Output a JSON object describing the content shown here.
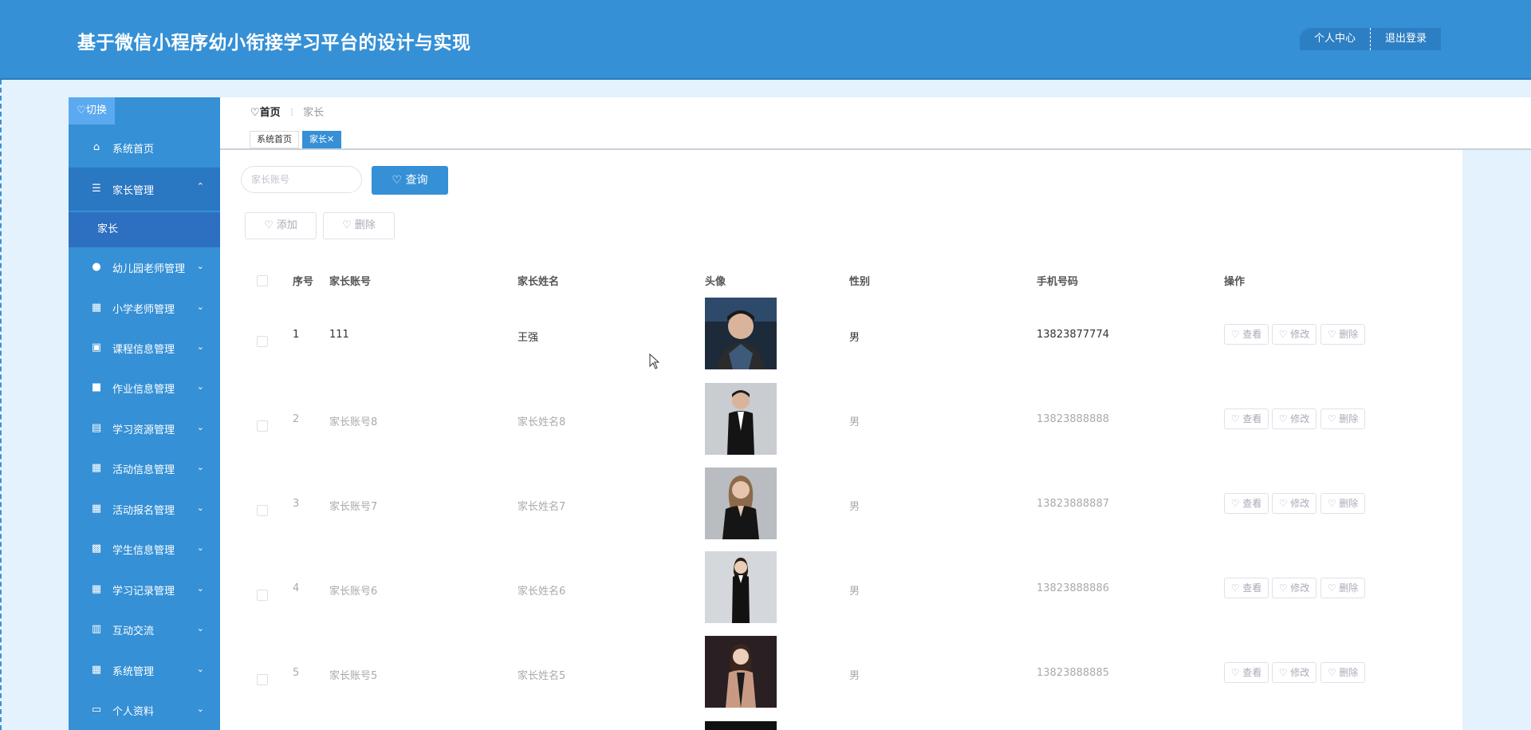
{
  "header": {
    "title": "基于微信小程序幼小衔接学习平台的设计与实现",
    "profile_label": "个人中心",
    "logout_label": "退出登录"
  },
  "sidebar": {
    "toggle_label": "切换",
    "items": [
      {
        "label": "系统首页",
        "icon": "home-icon"
      },
      {
        "label": "家长管理",
        "icon": "list-icon",
        "open": true
      },
      {
        "label": "幼儿园老师管理",
        "icon": "user-icon"
      },
      {
        "label": "小学老师管理",
        "icon": "grid-icon"
      },
      {
        "label": "课程信息管理",
        "icon": "briefcase-icon"
      },
      {
        "label": "作业信息管理",
        "icon": "chat-icon"
      },
      {
        "label": "学习资源管理",
        "icon": "book-icon"
      },
      {
        "label": "活动信息管理",
        "icon": "grid-icon"
      },
      {
        "label": "活动报名管理",
        "icon": "grid-icon"
      },
      {
        "label": "学生信息管理",
        "icon": "table-icon"
      },
      {
        "label": "学习记录管理",
        "icon": "grid-icon"
      },
      {
        "label": "互动交流",
        "icon": "clipboard-icon"
      },
      {
        "label": "系统管理",
        "icon": "grid-icon"
      },
      {
        "label": "个人资料",
        "icon": "id-card-icon"
      }
    ],
    "sub_item": "家长"
  },
  "breadcrumb": {
    "home": "首页",
    "current": "家长"
  },
  "tabs": [
    {
      "label": "系统首页"
    },
    {
      "label": "家长✕",
      "active": true
    }
  ],
  "search": {
    "placeholder": "家长账号",
    "button": "查询"
  },
  "actions": {
    "add": "添加",
    "delete": "删除"
  },
  "table": {
    "headers": [
      "序号",
      "家长账号",
      "家长姓名",
      "头像",
      "性别",
      "手机号码",
      "操作"
    ],
    "rows": [
      {
        "index": "1",
        "account": "111",
        "name": "王强",
        "gender": "男",
        "phone": "13823877774"
      },
      {
        "index": "2",
        "account": "家长账号8",
        "name": "家长姓名8",
        "gender": "男",
        "phone": "13823888888"
      },
      {
        "index": "3",
        "account": "家长账号7",
        "name": "家长姓名7",
        "gender": "男",
        "phone": "13823888887"
      },
      {
        "index": "4",
        "account": "家长账号6",
        "name": "家长姓名6",
        "gender": "男",
        "phone": "13823888886"
      },
      {
        "index": "5",
        "account": "家长账号5",
        "name": "家长姓名5",
        "gender": "男",
        "phone": "13823888885"
      }
    ],
    "row_actions": {
      "view": "查看",
      "edit": "修改",
      "delete": "删除"
    }
  },
  "colors": {
    "primary": "#3590d6",
    "sidebar_open": "#2a77c2",
    "page_bg": "#e3f2fc"
  }
}
